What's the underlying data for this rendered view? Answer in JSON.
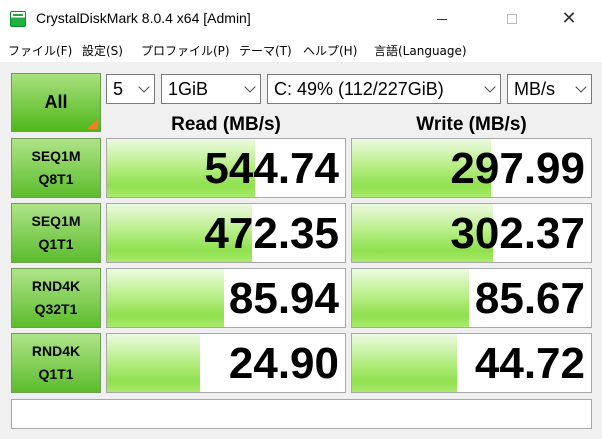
{
  "window": {
    "title": "CrystalDiskMark 8.0.4 x64 [Admin]",
    "close_glyph": "✕"
  },
  "menu": [
    "ファイル(F)",
    "設定(S)",
    "プロファイル(P)",
    "テーマ(T)",
    "ヘルプ(H)",
    "言語(Language)"
  ],
  "controls": {
    "all_label": "All",
    "count": "5",
    "size": "1GiB",
    "drive": "C: 49% (112/227GiB)",
    "unit": "MB/s"
  },
  "headers": {
    "read": "Read (MB/s)",
    "write": "Write (MB/s)"
  },
  "rows": [
    {
      "line1": "SEQ1M",
      "line2": "Q8T1",
      "read": "544.74",
      "write": "297.99",
      "read_level": 0.62,
      "write_level": 0.58
    },
    {
      "line1": "SEQ1M",
      "line2": "Q1T1",
      "read": "472.35",
      "write": "302.37",
      "read_level": 0.61,
      "write_level": 0.59
    },
    {
      "line1": "RND4K",
      "line2": "Q32T1",
      "read": "85.94",
      "write": "85.67",
      "read_level": 0.49,
      "write_level": 0.49
    },
    {
      "line1": "RND4K",
      "line2": "Q1T1",
      "read": "24.90",
      "write": "44.72",
      "read_level": 0.39,
      "write_level": 0.44
    }
  ],
  "status": "",
  "colors": {
    "bar_green": "#8fe04e",
    "button_green": "#5cbc2c",
    "corner_orange": "#f07f20"
  }
}
